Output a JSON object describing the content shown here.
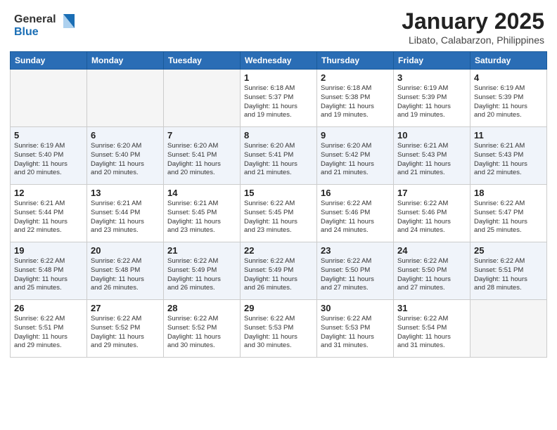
{
  "header": {
    "logo_general": "General",
    "logo_blue": "Blue",
    "title": "January 2025",
    "subtitle": "Libato, Calabarzon, Philippines"
  },
  "days": [
    "Sunday",
    "Monday",
    "Tuesday",
    "Wednesday",
    "Thursday",
    "Friday",
    "Saturday"
  ],
  "weeks": [
    [
      {
        "day": "",
        "info": ""
      },
      {
        "day": "",
        "info": ""
      },
      {
        "day": "",
        "info": ""
      },
      {
        "day": "1",
        "info": "Sunrise: 6:18 AM\nSunset: 5:37 PM\nDaylight: 11 hours\nand 19 minutes."
      },
      {
        "day": "2",
        "info": "Sunrise: 6:18 AM\nSunset: 5:38 PM\nDaylight: 11 hours\nand 19 minutes."
      },
      {
        "day": "3",
        "info": "Sunrise: 6:19 AM\nSunset: 5:39 PM\nDaylight: 11 hours\nand 19 minutes."
      },
      {
        "day": "4",
        "info": "Sunrise: 6:19 AM\nSunset: 5:39 PM\nDaylight: 11 hours\nand 20 minutes."
      }
    ],
    [
      {
        "day": "5",
        "info": "Sunrise: 6:19 AM\nSunset: 5:40 PM\nDaylight: 11 hours\nand 20 minutes."
      },
      {
        "day": "6",
        "info": "Sunrise: 6:20 AM\nSunset: 5:40 PM\nDaylight: 11 hours\nand 20 minutes."
      },
      {
        "day": "7",
        "info": "Sunrise: 6:20 AM\nSunset: 5:41 PM\nDaylight: 11 hours\nand 20 minutes."
      },
      {
        "day": "8",
        "info": "Sunrise: 6:20 AM\nSunset: 5:41 PM\nDaylight: 11 hours\nand 21 minutes."
      },
      {
        "day": "9",
        "info": "Sunrise: 6:20 AM\nSunset: 5:42 PM\nDaylight: 11 hours\nand 21 minutes."
      },
      {
        "day": "10",
        "info": "Sunrise: 6:21 AM\nSunset: 5:43 PM\nDaylight: 11 hours\nand 21 minutes."
      },
      {
        "day": "11",
        "info": "Sunrise: 6:21 AM\nSunset: 5:43 PM\nDaylight: 11 hours\nand 22 minutes."
      }
    ],
    [
      {
        "day": "12",
        "info": "Sunrise: 6:21 AM\nSunset: 5:44 PM\nDaylight: 11 hours\nand 22 minutes."
      },
      {
        "day": "13",
        "info": "Sunrise: 6:21 AM\nSunset: 5:44 PM\nDaylight: 11 hours\nand 23 minutes."
      },
      {
        "day": "14",
        "info": "Sunrise: 6:21 AM\nSunset: 5:45 PM\nDaylight: 11 hours\nand 23 minutes."
      },
      {
        "day": "15",
        "info": "Sunrise: 6:22 AM\nSunset: 5:45 PM\nDaylight: 11 hours\nand 23 minutes."
      },
      {
        "day": "16",
        "info": "Sunrise: 6:22 AM\nSunset: 5:46 PM\nDaylight: 11 hours\nand 24 minutes."
      },
      {
        "day": "17",
        "info": "Sunrise: 6:22 AM\nSunset: 5:46 PM\nDaylight: 11 hours\nand 24 minutes."
      },
      {
        "day": "18",
        "info": "Sunrise: 6:22 AM\nSunset: 5:47 PM\nDaylight: 11 hours\nand 25 minutes."
      }
    ],
    [
      {
        "day": "19",
        "info": "Sunrise: 6:22 AM\nSunset: 5:48 PM\nDaylight: 11 hours\nand 25 minutes."
      },
      {
        "day": "20",
        "info": "Sunrise: 6:22 AM\nSunset: 5:48 PM\nDaylight: 11 hours\nand 26 minutes."
      },
      {
        "day": "21",
        "info": "Sunrise: 6:22 AM\nSunset: 5:49 PM\nDaylight: 11 hours\nand 26 minutes."
      },
      {
        "day": "22",
        "info": "Sunrise: 6:22 AM\nSunset: 5:49 PM\nDaylight: 11 hours\nand 26 minutes."
      },
      {
        "day": "23",
        "info": "Sunrise: 6:22 AM\nSunset: 5:50 PM\nDaylight: 11 hours\nand 27 minutes."
      },
      {
        "day": "24",
        "info": "Sunrise: 6:22 AM\nSunset: 5:50 PM\nDaylight: 11 hours\nand 27 minutes."
      },
      {
        "day": "25",
        "info": "Sunrise: 6:22 AM\nSunset: 5:51 PM\nDaylight: 11 hours\nand 28 minutes."
      }
    ],
    [
      {
        "day": "26",
        "info": "Sunrise: 6:22 AM\nSunset: 5:51 PM\nDaylight: 11 hours\nand 29 minutes."
      },
      {
        "day": "27",
        "info": "Sunrise: 6:22 AM\nSunset: 5:52 PM\nDaylight: 11 hours\nand 29 minutes."
      },
      {
        "day": "28",
        "info": "Sunrise: 6:22 AM\nSunset: 5:52 PM\nDaylight: 11 hours\nand 30 minutes."
      },
      {
        "day": "29",
        "info": "Sunrise: 6:22 AM\nSunset: 5:53 PM\nDaylight: 11 hours\nand 30 minutes."
      },
      {
        "day": "30",
        "info": "Sunrise: 6:22 AM\nSunset: 5:53 PM\nDaylight: 11 hours\nand 31 minutes."
      },
      {
        "day": "31",
        "info": "Sunrise: 6:22 AM\nSunset: 5:54 PM\nDaylight: 11 hours\nand 31 minutes."
      },
      {
        "day": "",
        "info": ""
      }
    ]
  ]
}
